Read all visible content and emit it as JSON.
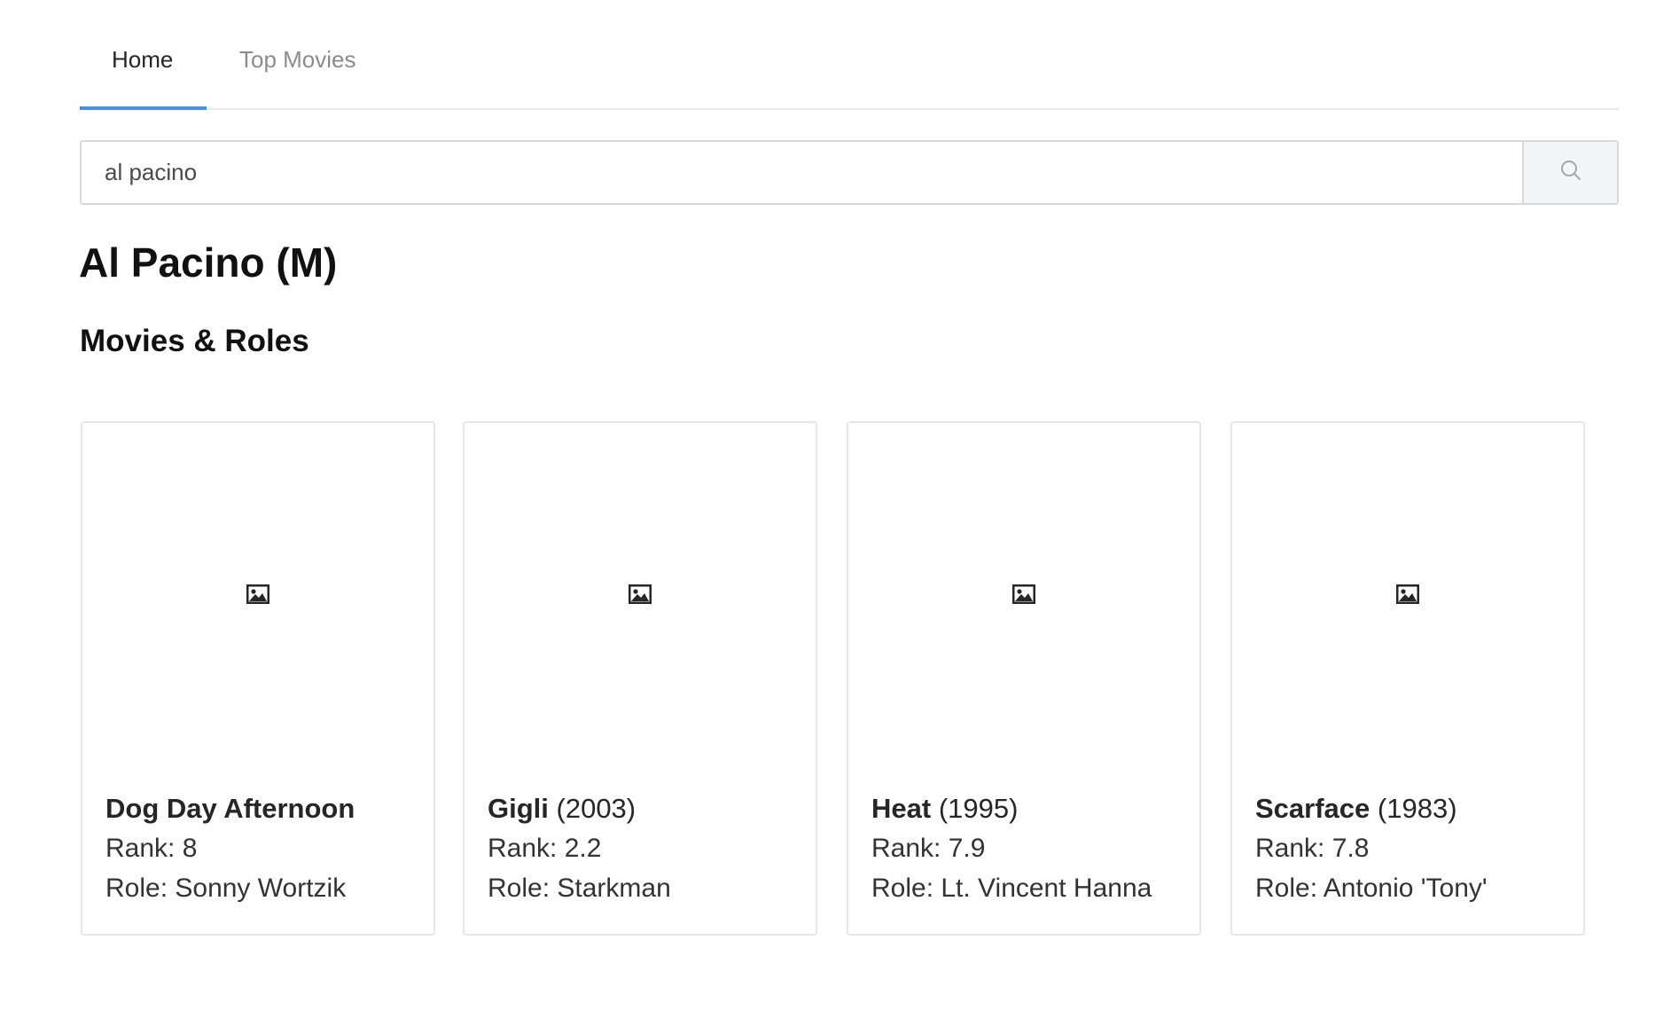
{
  "tabs": {
    "home": "Home",
    "top_movies": "Top Movies"
  },
  "search": {
    "value": "al pacino"
  },
  "person": {
    "title": "Al Pacino (M)"
  },
  "section": {
    "title": "Movies & Roles"
  },
  "movies": [
    {
      "title": "Dog Day Afternoon",
      "year": "",
      "rank": "Rank: 8",
      "role": "Role: Sonny Wortzik"
    },
    {
      "title": "Gigli",
      "year": "(2003)",
      "rank": "Rank: 2.2",
      "role": "Role: Starkman"
    },
    {
      "title": "Heat",
      "year": "(1995)",
      "rank": "Rank: 7.9",
      "role": "Role: Lt. Vincent Hanna"
    },
    {
      "title": "Scarface",
      "year": "(1983)",
      "rank": "Rank: 7.8",
      "role": "Role: Antonio 'Tony'"
    }
  ],
  "colors": {
    "accent": "#4a90e2",
    "border": "#e8e8e8",
    "muted_text": "#8c8c8c"
  }
}
